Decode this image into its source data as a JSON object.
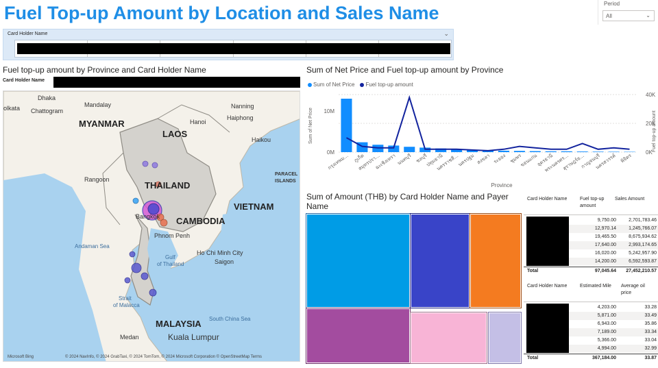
{
  "title": "Fuel Top-up Amount by Location and Sales Name",
  "period": {
    "label": "Period",
    "value": "All"
  },
  "card_slicer": {
    "label": "Card Holder Name"
  },
  "map_visual": {
    "title": "Fuel top-up amount by Province and Card Holder Name",
    "legend_label": "Card Holder Name",
    "labels": {
      "myanmar": "MYANMAR",
      "laos": "LAOS",
      "thailand": "THAILAND",
      "vietnam": "VIETNAM",
      "cambodia": "CAMBODIA",
      "malaysia": "MALAYSIA",
      "mandalay": "Mandalay",
      "hanoi": "Hanoi",
      "nanning": "Nanning",
      "haiphong": "Haiphong",
      "haikou": "Haikou",
      "rangoon": "Rangoon",
      "bangkok": "Bangkok",
      "phnompenh": "Phnom Penh",
      "hcmc": "Ho Chi Minh City",
      "saigon": "Saigon",
      "kualalumpur": "Kuala Lumpur",
      "medan": "Medan",
      "chattogram": "Chattogram",
      "kolkata": "olkata",
      "dhaka": "Dhaka",
      "paracel": "PARACEL",
      "islands": "ISLANDS",
      "andaman": "Andaman Sea",
      "gulf": "Gulf",
      "ofthailand": "of Thailand",
      "southchina": "South China Sea",
      "strait": "Strait",
      "ofmalacca": "of Malacca"
    },
    "attribution": "© 2024 NavInfo, © 2024 GrabTaxi, © 2024 TomTom, © 2024 Microsoft Corporation  © OpenStreetMap  Terms",
    "bing": "Microsoft Bing"
  },
  "combo": {
    "title": "Sum of Net Price and Fuel top-up amount by Province",
    "legend": [
      {
        "name": "Sum of Net Price",
        "color": "#118dff"
      },
      {
        "name": "Fuel top-up amount",
        "color": "#12239e"
      }
    ]
  },
  "chart_data": {
    "type": "bar",
    "title": "Sum of Net Price and Fuel top-up amount by Province",
    "xlabel": "Province",
    "ylabel": "Sum of Net Price",
    "y2label": "Fuel top-up amount",
    "yticks": [
      "0M",
      "10M"
    ],
    "y2ticks": [
      "0K",
      "20K",
      "40K"
    ],
    "ylim": [
      0,
      14
    ],
    "y2lim": [
      0,
      40
    ],
    "categories": [
      "กรุงเทพม...",
      "ภูเก็ต",
      "สมุทรปรา...",
      "ฉะเชิงเทรา",
      "นนทบุรี",
      "ชลบุรี",
      "ปทุมธานี",
      "นครราชสี...",
      "นครปฐม",
      "สงขลา",
      "ระยอง",
      "ชุมพร",
      "ขอนแก่น",
      "อุดรธานี",
      "พระนครศร...",
      "สุราษฎร์ธ...",
      "กาญจนบุรี",
      "นครสวรรค์",
      "พิจิตร"
    ],
    "series": [
      {
        "name": "Sum of Net Price",
        "type": "bar",
        "unit": "M",
        "values": [
          13.0,
          2.4,
          1.8,
          1.6,
          1.3,
          1.1,
          0.9,
          0.7,
          0.5,
          0.4,
          0.35,
          0.3,
          0.25,
          0.2,
          0.2,
          0.15,
          0.12,
          0.1,
          0.08
        ]
      },
      {
        "name": "Fuel top-up amount",
        "type": "line",
        "unit": "K",
        "values": [
          10,
          4,
          3,
          3,
          38,
          2,
          2,
          2,
          1.5,
          1,
          2,
          4,
          3,
          2,
          2,
          6,
          2,
          3,
          2
        ]
      }
    ]
  },
  "treemap": {
    "title_line1": "Sum of Amount (THB) by Card Holder Name and Payer",
    "title_line2": "Name",
    "colors": [
      "#009ce6",
      "#3944c8",
      "#f47b20",
      "#a34c9f",
      "#f8b4d6",
      "#c4bfe6"
    ]
  },
  "table1": {
    "headers": [
      "Card Holder Name",
      "Fuel top-up amount",
      "Sales Amount"
    ],
    "rows": [
      [
        "9,750.00",
        "2,701,783.46"
      ],
      [
        "12,970.14",
        "1,245,766.07"
      ],
      [
        "19,465.50",
        "8,675,934.62"
      ],
      [
        "17,640.00",
        "2,993,174.65"
      ],
      [
        "16,020.00",
        "5,242,957.90"
      ],
      [
        "14,200.00",
        "6,592,593.87"
      ]
    ],
    "total_label": "Total",
    "total": [
      "97,045.64",
      "27,452,210.57"
    ]
  },
  "table2": {
    "headers": [
      "Card Holder Name",
      "Estimated Mile",
      "Average oil price"
    ],
    "rows": [
      [
        "4,203.00",
        "33.28"
      ],
      [
        "5,871.00",
        "33.49"
      ],
      [
        "6,943.00",
        "35.86"
      ],
      [
        "7,189.00",
        "33.34"
      ],
      [
        "5,366.00",
        "33.04"
      ],
      [
        "4,994.00",
        "32.99"
      ]
    ],
    "total_label": "Total",
    "total": [
      "367,184.00",
      "33.87"
    ]
  }
}
